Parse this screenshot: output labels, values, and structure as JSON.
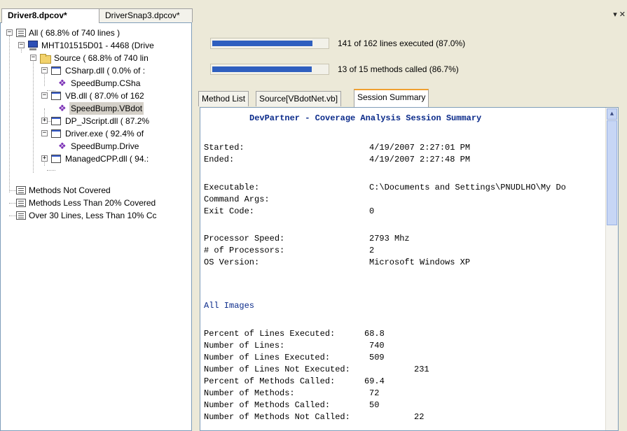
{
  "document_tabs": [
    {
      "label": "Driver8.dpcov*",
      "active": true
    },
    {
      "label": "DriverSnap3.dpcov*",
      "active": false
    }
  ],
  "tab_menu_glyph": "▾ ✕",
  "tree": {
    "nodes": [
      {
        "label": "All ( 68.8% of 740 lines )",
        "icon": "list-icon",
        "expander": "−"
      },
      {
        "label": "MHT101515D01 - 4468 (Drive",
        "icon": "computer-icon",
        "expander": "−"
      },
      {
        "label": "Source ( 68.8% of 740 lin",
        "icon": "folder-icon",
        "expander": "−"
      },
      {
        "label": "CSharp.dll ( 0.0% of :",
        "icon": "dll-icon",
        "expander": "−"
      },
      {
        "label": "SpeedBump.CSha",
        "icon": "method-icon",
        "expander": ""
      },
      {
        "label": "VB.dll ( 87.0% of 162",
        "icon": "dll-icon",
        "expander": "−"
      },
      {
        "label": "SpeedBump.VBdot",
        "icon": "method-icon",
        "expander": ""
      },
      {
        "label": "DP_JScript.dll ( 87.2%",
        "icon": "dll-icon",
        "expander": "+"
      },
      {
        "label": "Driver.exe ( 92.4% of",
        "icon": "dll-icon",
        "expander": "−"
      },
      {
        "label": "SpeedBump.Drive",
        "icon": "method-icon",
        "expander": ""
      },
      {
        "label": "ManagedCPP.dll ( 94.:",
        "icon": "dll-icon",
        "expander": "+"
      },
      {
        "label": "Methods Not Covered",
        "icon": "list-icon",
        "expander": ""
      },
      {
        "label": "Methods Less Than 20% Covered",
        "icon": "list-icon",
        "expander": ""
      },
      {
        "label": "Over 30 Lines, Less Than 10% Cc",
        "icon": "list-icon",
        "expander": ""
      }
    ]
  },
  "progress": [
    {
      "label": "141 of 162 lines executed (87.0%)",
      "fraction": 0.87
    },
    {
      "label": "13 of 15 methods called (86.7%)",
      "fraction": 0.867
    }
  ],
  "inner_tabs": [
    {
      "label": "Method List",
      "active": false
    },
    {
      "label": "Source[VBdotNet.vb]",
      "active": false
    },
    {
      "label": "Session Summary",
      "active": true
    }
  ],
  "report": {
    "title": "DevPartner - Coverage Analysis Session Summary",
    "fields": [
      {
        "label": "Started:",
        "value": "4/19/2007 2:27:01 PM"
      },
      {
        "label": "Ended:",
        "value": "4/19/2007 2:27:48 PM"
      },
      {
        "label": "Executable:",
        "value": "C:\\Documents and Settings\\PNUDLHO\\My Do"
      },
      {
        "label": "Command Args:",
        "value": ""
      },
      {
        "label": "Exit Code:",
        "value": "0"
      },
      {
        "label": "Processor Speed:",
        "value": "2793 Mhz"
      },
      {
        "label": "# of Processors:",
        "value": "2"
      },
      {
        "label": "OS Version:",
        "value": "Microsoft Windows XP"
      }
    ],
    "section_title": "All Images",
    "stats": [
      {
        "label": "Percent of Lines Executed:",
        "value": "68.8"
      },
      {
        "label": "Number of Lines:",
        "value": "740"
      },
      {
        "label": "Number of Lines Executed:",
        "value": "509"
      },
      {
        "label": "Number of Lines Not Executed:",
        "value": "231"
      },
      {
        "label": "Percent of Methods Called:",
        "value": "69.4"
      },
      {
        "label": "Number of Methods:",
        "value": "72"
      },
      {
        "label": "Number of Methods Called:",
        "value": "50"
      },
      {
        "label": "Number of Methods Not Called:",
        "value": "22"
      }
    ]
  }
}
